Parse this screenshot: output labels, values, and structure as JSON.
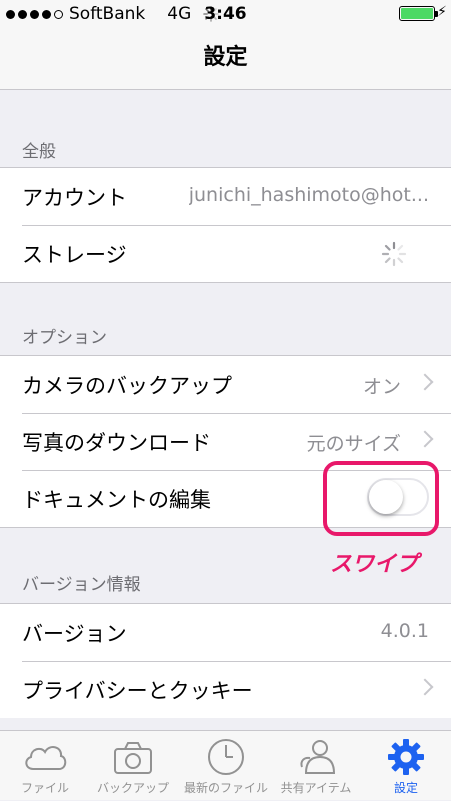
{
  "status_bar": {
    "carrier": "SoftBank",
    "network": "4G",
    "time": "3:46"
  },
  "nav": {
    "title": "設定"
  },
  "sections": {
    "general": {
      "header": "全般",
      "account_label": "アカウント",
      "account_value": "junichi_hashimoto@hot...",
      "storage_label": "ストレージ"
    },
    "options": {
      "header": "オプション",
      "camera_backup_label": "カメラのバックアップ",
      "camera_backup_value": "オン",
      "photo_download_label": "写真のダウンロード",
      "photo_download_value": "元のサイズ",
      "document_edit_label": "ドキュメントの編集",
      "document_edit_enabled": false
    },
    "version": {
      "header": "バージョン情報",
      "version_label": "バージョン",
      "version_value": "4.0.1",
      "privacy_label": "プライバシーとクッキー"
    }
  },
  "annotation": {
    "text": "スワイプ",
    "color": "#e8186a"
  },
  "tabs": [
    {
      "label": "ファイル",
      "icon": "cloud-icon"
    },
    {
      "label": "バックアップ",
      "icon": "camera-icon"
    },
    {
      "label": "最新のファイル",
      "icon": "clock-icon"
    },
    {
      "label": "共有アイテム",
      "icon": "people-icon"
    },
    {
      "label": "設定",
      "icon": "gear-icon",
      "active": true
    }
  ],
  "colors": {
    "accent": "#1d62f0",
    "battery": "#4cd964"
  }
}
